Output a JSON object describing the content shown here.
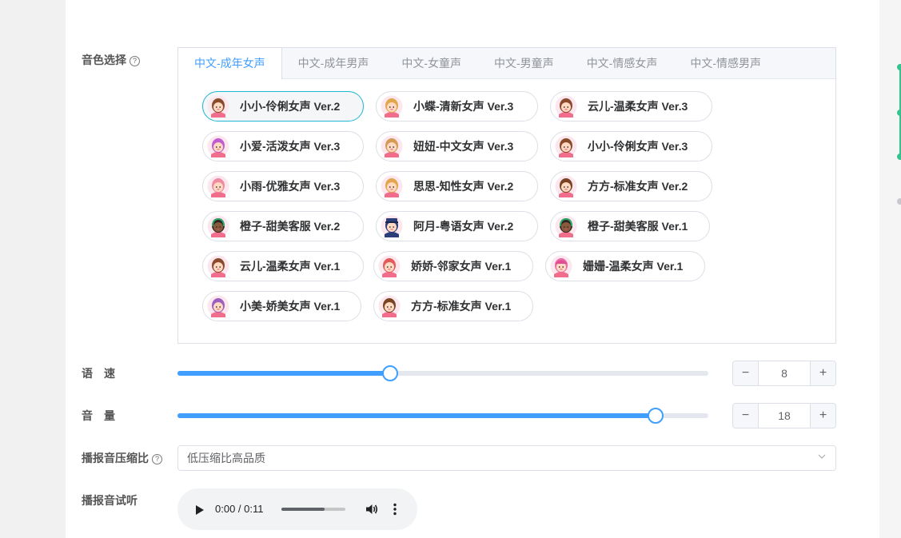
{
  "labels": {
    "voice": "音色选择",
    "speed": "语　速",
    "volume": "音　量",
    "compression": "播报音压缩比",
    "preview": "播报音试听",
    "help_glyph": "?"
  },
  "tabs": [
    {
      "label": "中文-成年女声",
      "active": true
    },
    {
      "label": "中文-成年男声",
      "active": false
    },
    {
      "label": "中文-女童声",
      "active": false
    },
    {
      "label": "中文-男童声",
      "active": false
    },
    {
      "label": "中文-情感女声",
      "active": false
    },
    {
      "label": "中文-情感男声",
      "active": false
    }
  ],
  "voices": [
    {
      "label": "小小-伶俐女声 Ver.2",
      "selected": true,
      "avatar": "girl-bob-brown"
    },
    {
      "label": "小蝶-清新女声 Ver.3",
      "selected": false,
      "avatar": "girl-blonde-bangs"
    },
    {
      "label": "云儿-温柔女声 Ver.3",
      "selected": false,
      "avatar": "girl-pigtails-brown"
    },
    {
      "label": "小爱-活泼女声 Ver.3",
      "selected": false,
      "avatar": "girl-purple-hair"
    },
    {
      "label": "妞妞-中文女声 Ver.3",
      "selected": false,
      "avatar": "girl-blonde-curls"
    },
    {
      "label": "小小-伶俐女声 Ver.3",
      "selected": false,
      "avatar": "girl-bob-brown"
    },
    {
      "label": "小雨-优雅女声 Ver.3",
      "selected": false,
      "avatar": "girl-pink-hair"
    },
    {
      "label": "思思-知性女声 Ver.2",
      "selected": false,
      "avatar": "girl-blonde-long"
    },
    {
      "label": "方方-标准女声 Ver.2",
      "selected": false,
      "avatar": "girl-brown-bangs"
    },
    {
      "label": "橙子-甜美客服 Ver.2",
      "selected": false,
      "avatar": "girl-headset-dark"
    },
    {
      "label": "阿月-粤语女声 Ver.2",
      "selected": false,
      "avatar": "police-officer"
    },
    {
      "label": "橙子-甜美客服 Ver.1",
      "selected": false,
      "avatar": "girl-headset-dark"
    },
    {
      "label": "云儿-温柔女声 Ver.1",
      "selected": false,
      "avatar": "girl-pigtails-brown"
    },
    {
      "label": "娇娇-邻家女声 Ver.1",
      "selected": false,
      "avatar": "girl-red-pigtails"
    },
    {
      "label": "姗姗-温柔女声 Ver.1",
      "selected": false,
      "avatar": "girl-pink-hat"
    },
    {
      "label": "小美-娇美女声 Ver.1",
      "selected": false,
      "avatar": "girl-purple-long"
    },
    {
      "label": "方方-标准女声 Ver.1",
      "selected": false,
      "avatar": "girl-brown-bob"
    }
  ],
  "speed": {
    "value": 8,
    "value_text": "8",
    "fraction": 0.4,
    "minus": "−",
    "plus": "+"
  },
  "volume": {
    "value": 18,
    "value_text": "18",
    "fraction": 0.9,
    "minus": "−",
    "plus": "+"
  },
  "compression": {
    "selected": "低压缩比高品质"
  },
  "audio": {
    "time": "0:00 / 0:11",
    "progress": 0.68
  },
  "colors": {
    "accent": "#409eff",
    "selected_border": "#1fb6d5",
    "rail_green": "#34c38f"
  }
}
